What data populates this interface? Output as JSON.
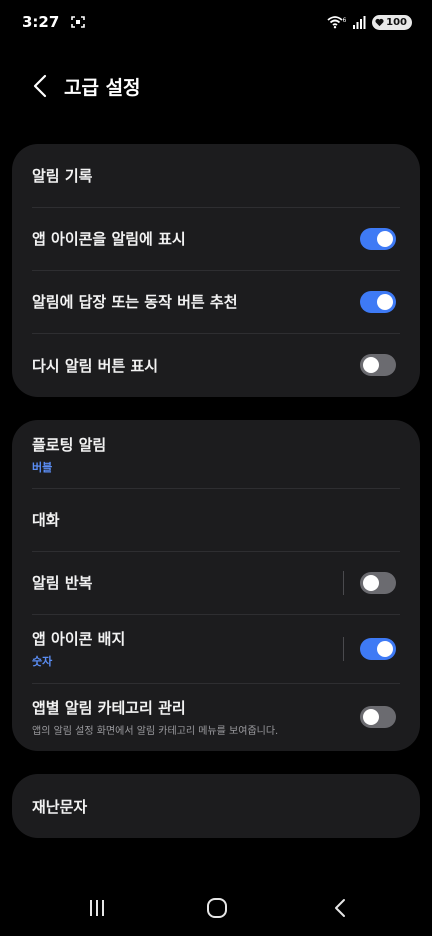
{
  "status_bar": {
    "time": "3:27",
    "battery": "100",
    "wifi_badge": "6"
  },
  "header": {
    "title": "고급 설정"
  },
  "group1": {
    "items": [
      {
        "title": "알림 기록"
      },
      {
        "title": "앱 아이콘을 알림에 표시",
        "toggle": "on"
      },
      {
        "title": "알림에 답장 또는 동작 버튼 추천",
        "toggle": "on"
      },
      {
        "title": "다시 알림 버튼 표시",
        "toggle": "off"
      }
    ]
  },
  "group2": {
    "items": [
      {
        "title": "플로팅 알림",
        "subtitle": "버블"
      },
      {
        "title": "대화"
      },
      {
        "title": "알림 반복",
        "toggle": "off"
      },
      {
        "title": "앱 아이콘 배지",
        "subtitle": "숫자",
        "toggle": "on"
      },
      {
        "title": "앱별 알림 카테고리 관리",
        "description": "앱의 알림 설정 화면에서 알림 카테고리 메뉴를 보여줍니다.",
        "toggle": "off"
      }
    ]
  },
  "group3": {
    "items": [
      {
        "title": "재난문자"
      }
    ]
  },
  "colors": {
    "background": "#000000",
    "card": "#1c1c1e",
    "accent": "#3e7af5",
    "subtitle": "#5b8ef5"
  }
}
